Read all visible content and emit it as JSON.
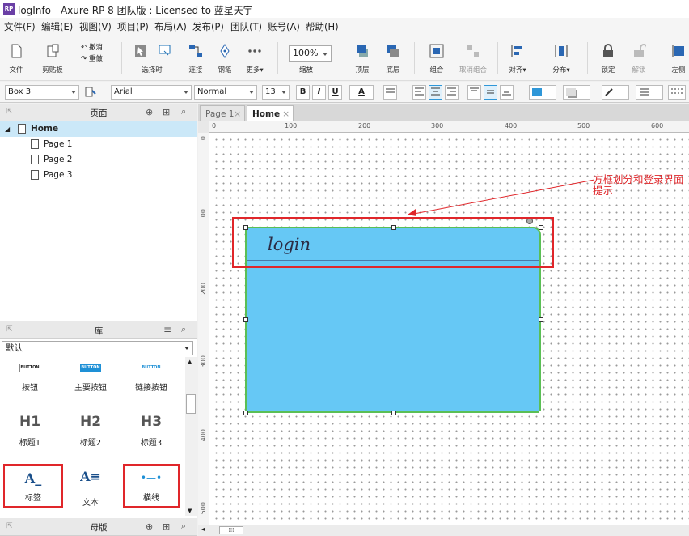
{
  "window": {
    "title": "logInfo - Axure RP 8 团队版 : Licensed to 蓝星天宇",
    "app_icon_text": "RP"
  },
  "menu": [
    "文件(F)",
    "编辑(E)",
    "视图(V)",
    "项目(P)",
    "布局(A)",
    "发布(P)",
    "团队(T)",
    "账号(A)",
    "帮助(H)"
  ],
  "toolbar": {
    "file": "文件",
    "clipboard": "剪贴板",
    "undo": "撤消",
    "redo": "重做",
    "select": "选择时",
    "connect": "连接",
    "pen": "钢笔",
    "more": "更多▾",
    "zoom_value": "100%",
    "zoom": "缩放",
    "top": "顶层",
    "bottom": "底层",
    "group": "组合",
    "ungroup": "取消组合",
    "align": "对齐▾",
    "distribute": "分布▾",
    "lock": "锁定",
    "unlock": "解锁",
    "left": "左侧"
  },
  "format": {
    "widget_name": "Box 3",
    "font": "Arial",
    "style": "Normal",
    "size": "13",
    "bold": "B",
    "italic": "I",
    "underline": "U",
    "font_color": "A"
  },
  "pages_panel": {
    "title": "页面",
    "home": "Home",
    "pages": [
      "Page 1",
      "Page 2",
      "Page 3"
    ]
  },
  "library_panel": {
    "title": "库",
    "selected": "默认",
    "items": [
      {
        "preview": "BUTTON",
        "label": "按钮"
      },
      {
        "preview": "BUTTON",
        "label": "主要按钮"
      },
      {
        "preview": "BUTTON",
        "label": "链接按钮"
      },
      {
        "preview": "H1",
        "label": "标题1"
      },
      {
        "preview": "H2",
        "label": "标题2"
      },
      {
        "preview": "H3",
        "label": "标题3"
      },
      {
        "preview": "A_",
        "label": "标签"
      },
      {
        "preview": "A≡",
        "label": "文本"
      },
      {
        "preview": "•—•",
        "label": "横线"
      }
    ]
  },
  "masters_panel": {
    "title": "母版"
  },
  "tabs": [
    {
      "label": "Page 1",
      "close": "×"
    },
    {
      "label": "Home",
      "close": "×"
    }
  ],
  "ruler": {
    "h": [
      "0",
      "100",
      "200",
      "300",
      "400",
      "500",
      "600"
    ],
    "v": [
      "0",
      "100",
      "200",
      "300",
      "400",
      "500"
    ]
  },
  "canvas": {
    "box_text": "login",
    "annotation": "方框划分和登录界面提示",
    "box_color": "#66c8f5",
    "box_border": "#5bbf55",
    "highlight_color": "#e0262a"
  },
  "scroll": {
    "thumb": "⁞⁞⁞"
  },
  "colors": {
    "accent": "#2f97d8",
    "selected_row": "#cbe8f8"
  }
}
